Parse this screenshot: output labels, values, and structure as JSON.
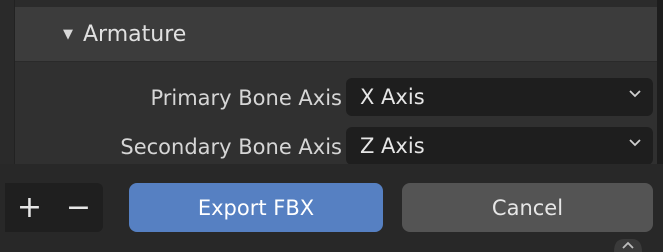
{
  "panel": {
    "title": "Armature",
    "collapse_icon": "triangle-down-icon",
    "rows": [
      {
        "label": "Primary Bone Axis",
        "value": "X Axis"
      },
      {
        "label": "Secondary Bone Axis",
        "value": "Z Axis"
      }
    ]
  },
  "footer": {
    "add_label": "+",
    "remove_label": "−",
    "export_label": "Export FBX",
    "cancel_label": "Cancel"
  },
  "colors": {
    "accent": "#5680c2",
    "background": "#303030",
    "header": "#3c3c3c",
    "field": "#1e1e1e",
    "footer": "#282828"
  }
}
